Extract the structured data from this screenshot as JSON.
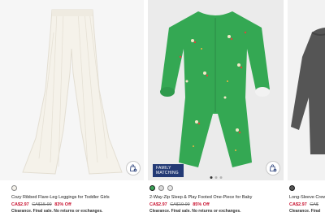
{
  "products": [
    {
      "name": "Cozy Ribbed Flare-Leg Leggings for Toddler Girls",
      "price_now": "CA$2.97",
      "price_was": "CA$15.99",
      "discount": "83% Off",
      "clearance": "Clearance. Final sale. No returns or exchanges.",
      "swatch_colors": [
        "#f4f1ea"
      ],
      "image_icon": "leggings-image"
    },
    {
      "name": "2-Way-Zip Sleep & Play Footed One-Piece for Baby",
      "price_now": "CA$2.97",
      "price_was": "CA$19.99",
      "discount": "85% Off",
      "clearance": "Clearance. Final sale. No returns or exchanges.",
      "badge": "FAMILY MATCHING",
      "swatch_colors": [
        "#3aa357",
        "#d9d9d9",
        "#e8e8e8"
      ],
      "image_icon": "onesie-image"
    },
    {
      "name": "Long-Sleeve Crew",
      "price_now": "CA$2.97",
      "price_was": "CA$",
      "clearance": "Clearance. Final",
      "swatch_colors": [
        "#555555"
      ],
      "image_icon": "sweater-image"
    }
  ],
  "colors": {
    "sale_red": "#c8102e",
    "badge_navy": "#233a75",
    "onesie_green": "#34a853"
  }
}
